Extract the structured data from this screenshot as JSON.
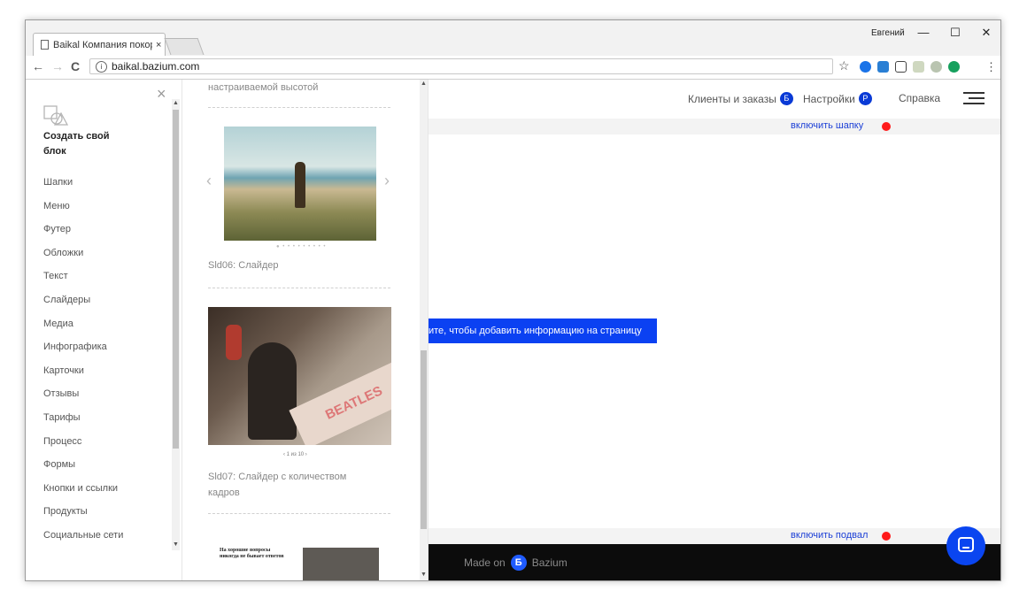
{
  "browser": {
    "tab_title": "Baikal Компания покорс",
    "tab_close": "×",
    "user_name": "Евгений",
    "win_minimize": "—",
    "win_maximize": "☐",
    "win_close": "✕",
    "nav_back": "←",
    "nav_forward": "→",
    "nav_reload": "C",
    "info_icon": "i",
    "url": "baikal.bazium.com",
    "bookmark_star": "☆",
    "menu": "⋮"
  },
  "site": {
    "nav": {
      "clients_label": "Клиенты и заказы",
      "clients_badge": "Б",
      "settings_label": "Настройки",
      "settings_badge": "Р",
      "help_label": "Справка"
    },
    "enable_header": "включить шапку",
    "cta_text": "ите, чтобы добавить информацию на страницу",
    "enable_footer": "включить подвал",
    "footer": {
      "made_on": "Made on",
      "logo_letter": "Б",
      "brand": "Bazium"
    },
    "accent_color": "#0b41f2",
    "status_dot_color": "#ff1a1a"
  },
  "left_panel": {
    "close": "×",
    "title": "Создать свой блок",
    "categories": [
      "Шапки",
      "Меню",
      "Футер",
      "Обложки",
      "Текст",
      "Слайдеры",
      "Медиа",
      "Инфографика",
      "Карточки",
      "Отзывы",
      "Тарифы",
      "Процесс",
      "Формы",
      "Кнопки и ссылки",
      "Продукты",
      "Социальные сети"
    ]
  },
  "mid_panel": {
    "prev_caption": "настраиваемой высотой",
    "item1_caption": "Sld06: Слайдер",
    "item2_caption": "Sld07: Слайдер с количеством кадров",
    "item2_pager": "‹  1 из 10  ›",
    "img2_text": "BEATLES",
    "item3_headline": "На хорошие вопросы никогда не бывает ответов"
  }
}
